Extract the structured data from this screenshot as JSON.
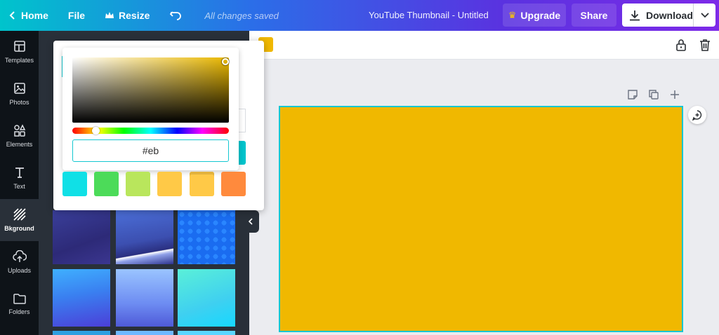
{
  "topbar": {
    "home_label": "Home",
    "file_label": "File",
    "resize_label": "Resize",
    "saved_status": "All changes saved",
    "document_title": "YouTube Thumbnail - Untitled",
    "upgrade_label": "Upgrade",
    "share_label": "Share",
    "download_label": "Download"
  },
  "rail": {
    "items": [
      {
        "label": "Templates",
        "icon": "templates-icon"
      },
      {
        "label": "Photos",
        "icon": "photos-icon"
      },
      {
        "label": "Elements",
        "icon": "elements-icon"
      },
      {
        "label": "Text",
        "icon": "text-icon"
      },
      {
        "label": "Bkground",
        "icon": "background-icon",
        "active": true
      },
      {
        "label": "Uploads",
        "icon": "uploads-icon"
      },
      {
        "label": "Folders",
        "icon": "folders-icon"
      }
    ]
  },
  "color_picker": {
    "hex_value": "#eb",
    "selected_color": "#eab800",
    "swatches": [
      "#10e0e6",
      "#4cdb59",
      "#b9e65c",
      "#ffc947",
      "#ffc947",
      "#ff8a3d"
    ]
  },
  "canvas": {
    "background_color": "#f0b800",
    "selection_color": "#14c7d1"
  },
  "colors": {
    "accent": "#00c4cc",
    "panel": "#293039",
    "rail": "#0e1318"
  }
}
